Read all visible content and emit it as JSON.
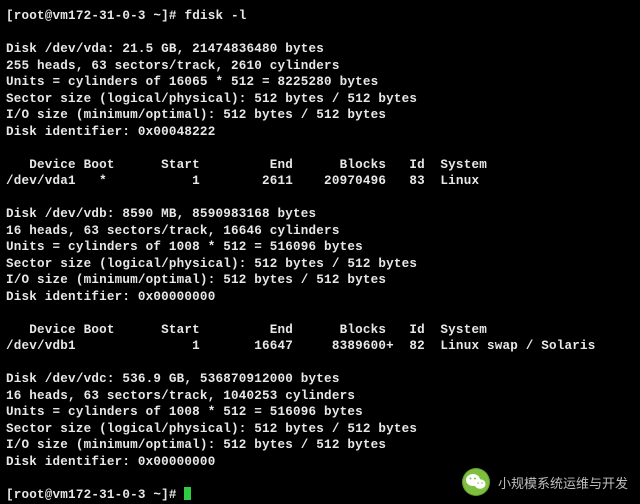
{
  "prompt1": "[root@vm172-31-0-3 ~]# ",
  "command1": "fdisk -l",
  "blank": "",
  "vda_header": "Disk /dev/vda: 21.5 GB, 21474836480 bytes",
  "vda_geom": "255 heads, 63 sectors/track, 2610 cylinders",
  "vda_units": "Units = cylinders of 16065 * 512 = 8225280 bytes",
  "vda_sector": "Sector size (logical/physical): 512 bytes / 512 bytes",
  "vda_io": "I/O size (minimum/optimal): 512 bytes / 512 bytes",
  "vda_id": "Disk identifier: 0x00048222",
  "ptable_header": "   Device Boot      Start         End      Blocks   Id  System",
  "vda_row1": "/dev/vda1   *           1        2611    20970496   83  Linux",
  "vdb_header": "Disk /dev/vdb: 8590 MB, 8590983168 bytes",
  "vdb_geom": "16 heads, 63 sectors/track, 16646 cylinders",
  "vdb_units": "Units = cylinders of 1008 * 512 = 516096 bytes",
  "vdb_sector": "Sector size (logical/physical): 512 bytes / 512 bytes",
  "vdb_io": "I/O size (minimum/optimal): 512 bytes / 512 bytes",
  "vdb_id": "Disk identifier: 0x00000000",
  "vdb_row1": "/dev/vdb1               1       16647     8389600+  82  Linux swap / Solaris",
  "vdc_header": "Disk /dev/vdc: 536.9 GB, 536870912000 bytes",
  "vdc_geom": "16 heads, 63 sectors/track, 1040253 cylinders",
  "vdc_units": "Units = cylinders of 1008 * 512 = 516096 bytes",
  "vdc_sector": "Sector size (logical/physical): 512 bytes / 512 bytes",
  "vdc_io": "I/O size (minimum/optimal): 512 bytes / 512 bytes",
  "vdc_id": "Disk identifier: 0x00000000",
  "prompt2": "[root@vm172-31-0-3 ~]# ",
  "watermark": "小规模系统运维与开发"
}
